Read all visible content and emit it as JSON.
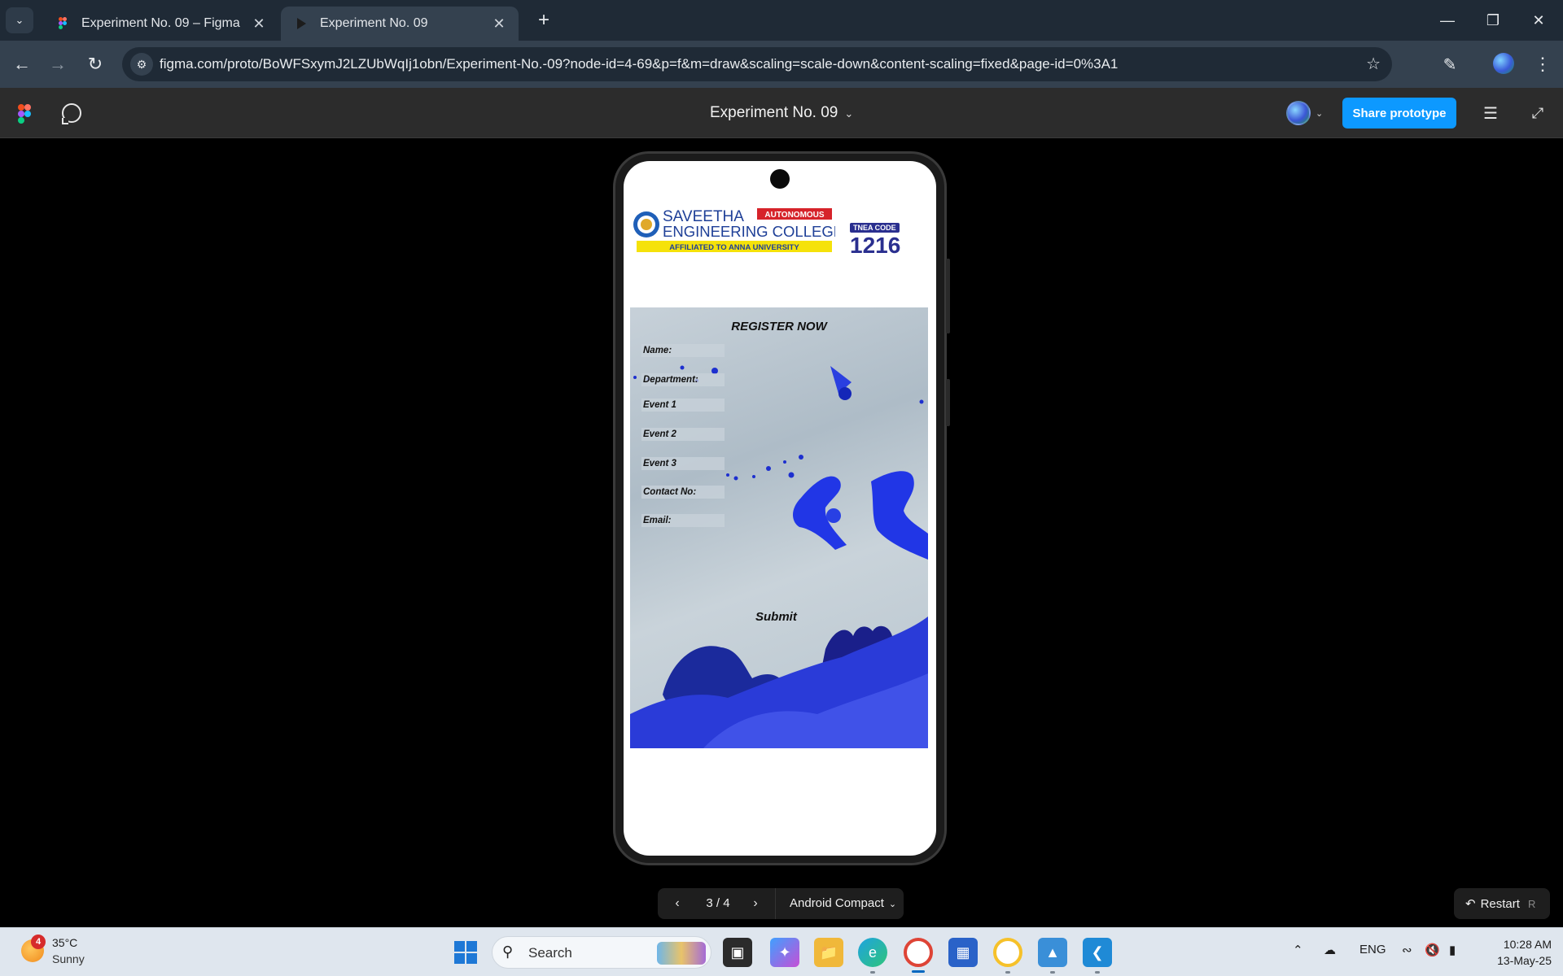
{
  "browser": {
    "tabs": [
      {
        "title": "Experiment No. 09 – Figma",
        "active": false,
        "favicon": "figma-icon"
      },
      {
        "title": "Experiment No. 09",
        "active": true,
        "favicon": "play-icon"
      }
    ],
    "url": "figma.com/proto/BoWFSxymJ2LZUbWqIj1obn/Experiment-No.-09?node-id=4-69&p=f&m=draw&scaling=scale-down&content-scaling=fixed&page-id=0%3A1"
  },
  "figma": {
    "file_title": "Experiment No. 09",
    "share_label": "Share prototype",
    "accent": "#0d99ff"
  },
  "poster": {
    "college": {
      "name_line1": "SAVEETHA",
      "name_line2": "ENGINEERING COLLEGE",
      "autonomous": "AUTONOMOUS",
      "affiliation": "AFFILIATED TO ANNA UNIVERSITY",
      "tnea_label": "TNEA CODE",
      "tnea_code": "1216"
    },
    "title": "REGISTER NOW",
    "fields": [
      "Name:",
      "Department:",
      "Event 1",
      "Event 2",
      "Event 3",
      "Contact No:",
      "Email:"
    ],
    "submit": "Submit"
  },
  "prototype_controls": {
    "page": "3 / 4",
    "device": "Android Compact",
    "restart": "Restart",
    "restart_key": "R"
  },
  "taskbar": {
    "weather_badge": "4",
    "temperature": "35°C",
    "condition": "Sunny",
    "search_placeholder": "Search",
    "language": "ENG",
    "time": "10:28 AM",
    "date": "13-May-25"
  }
}
